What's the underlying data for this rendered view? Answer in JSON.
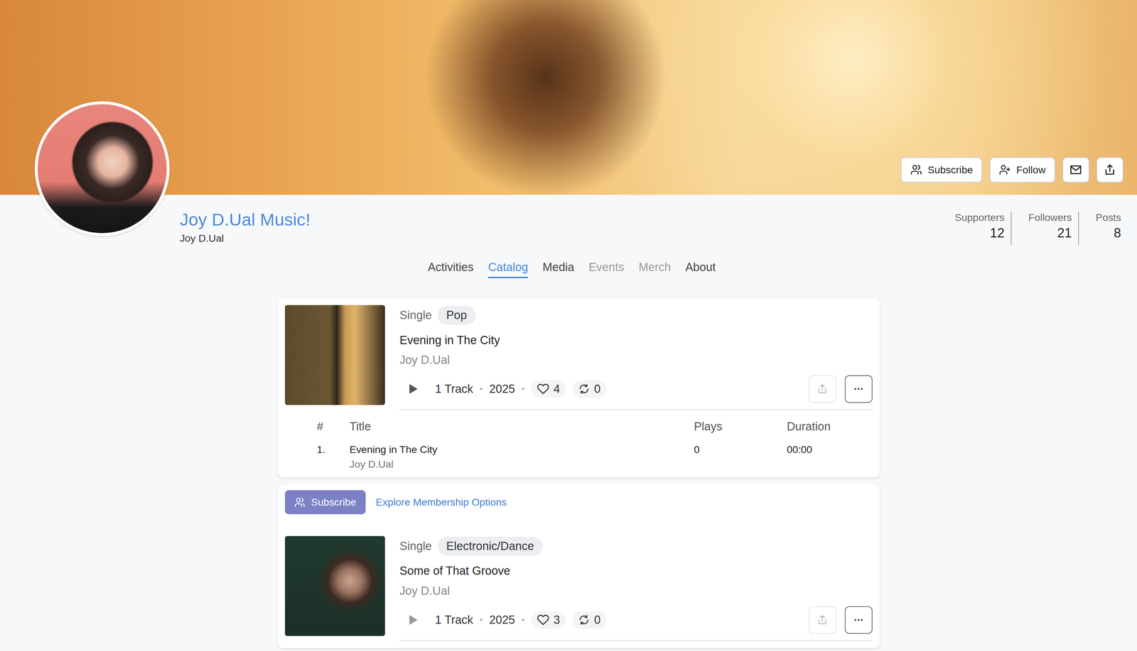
{
  "header": {
    "buttons": [
      {
        "label": "Subscribe",
        "icon": "users"
      },
      {
        "label": "Follow",
        "icon": "user-plus"
      }
    ],
    "icon_buttons": [
      "mail",
      "share"
    ]
  },
  "profile": {
    "title": "Joy D.Ual Music!",
    "name": "Joy D.Ual"
  },
  "stats": [
    {
      "label": "Supporters",
      "value": "12"
    },
    {
      "label": "Followers",
      "value": "21"
    },
    {
      "label": "Posts",
      "value": "8"
    }
  ],
  "tabs": [
    {
      "label": "Activities",
      "selected": false,
      "disabled": false
    },
    {
      "label": "Catalog",
      "selected": true,
      "disabled": false
    },
    {
      "label": "Media",
      "selected": false,
      "disabled": false
    },
    {
      "label": "Events",
      "selected": false,
      "disabled": true
    },
    {
      "label": "Merch",
      "selected": false,
      "disabled": true
    },
    {
      "label": "About",
      "selected": false,
      "disabled": false
    }
  ],
  "releases": [
    {
      "type": "Single",
      "genre": "Pop",
      "title": "Evening in The City",
      "artist": "Joy D.Ual",
      "tracks": "1 Track",
      "separator": "•",
      "year": "2025",
      "likes": "4",
      "reposts": "0",
      "track_table": {
        "columns": [
          "#",
          "Title",
          "Plays",
          "Duration"
        ],
        "rows": [
          {
            "num": "1.",
            "title": "Evening in The City",
            "artist": "Joy D.Ual",
            "plays": "0",
            "duration": "00:00"
          }
        ]
      }
    },
    {
      "type": "Single",
      "genre": "Electronic/Dance",
      "title": "Some of That Groove",
      "artist": "Joy D.Ual",
      "tracks": "1 Track",
      "separator": "•",
      "year": "2025",
      "likes": "3",
      "reposts": "0",
      "promo": {
        "button": "Subscribe",
        "link": "Explore Membership Options"
      }
    }
  ]
}
